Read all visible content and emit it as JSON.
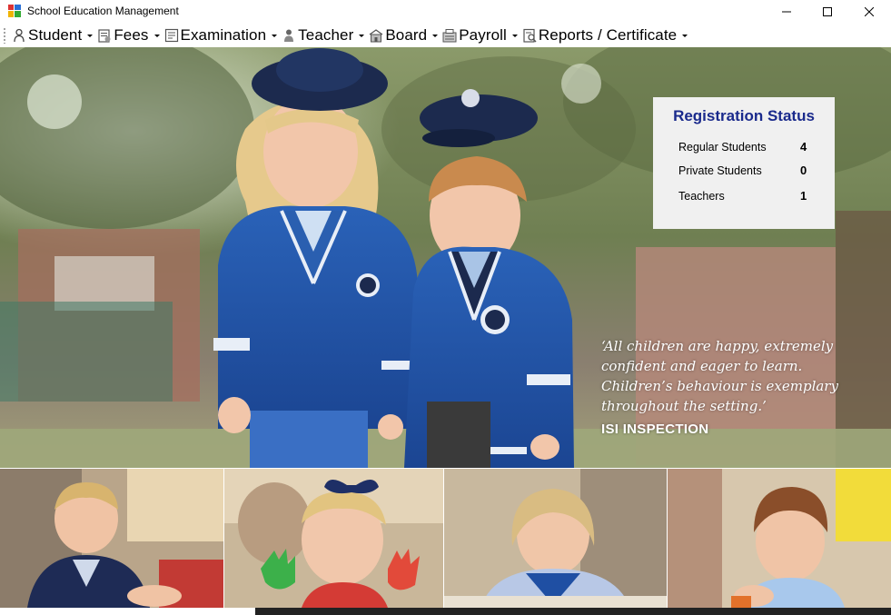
{
  "window": {
    "title": "School Education Management",
    "controls": {
      "minimize": "—",
      "maximize": "☐",
      "close": "✕"
    }
  },
  "menu": [
    {
      "label": "Student",
      "icon": "student-icon"
    },
    {
      "label": "Fees",
      "icon": "fees-icon"
    },
    {
      "label": "Examination",
      "icon": "examination-icon"
    },
    {
      "label": "Teacher",
      "icon": "teacher-icon"
    },
    {
      "label": "Board",
      "icon": "board-icon"
    },
    {
      "label": "Payroll",
      "icon": "payroll-icon"
    },
    {
      "label": "Reports / Certificate",
      "icon": "report-icon"
    }
  ],
  "registration": {
    "title": "Registration Status",
    "rows": [
      {
        "label": "Regular Students",
        "value": "4"
      },
      {
        "label": "Private Students",
        "value": "0"
      },
      {
        "label": "Teachers",
        "value": "1"
      }
    ]
  },
  "banner": {
    "quote_lines": [
      "‘All children are happy, extremely",
      "confident and eager to learn.",
      "Children’s behaviour is exemplary",
      "throughout the setting.’"
    ],
    "source": "ISI INSPECTION"
  },
  "colors": {
    "status_title": "#1a2a8c",
    "uniform_blue": "#1e4fa0",
    "panel_bg": "#f0f0f0"
  }
}
